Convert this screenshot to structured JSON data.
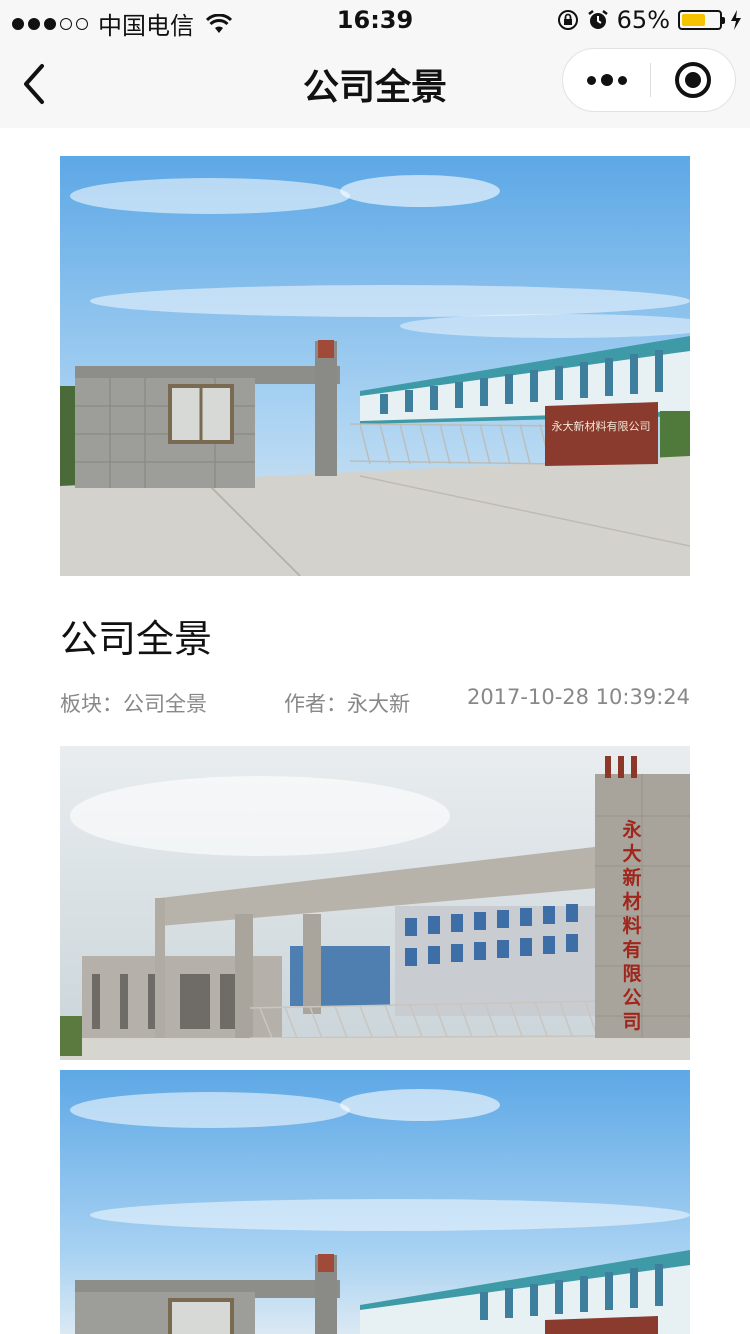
{
  "status_bar": {
    "carrier": "中国电信",
    "time": "16:39",
    "battery_percent": "65%",
    "battery_level": 0.65,
    "signal_bars": 3,
    "signal_total": 5
  },
  "nav": {
    "title": "公司全景",
    "back_icon": "chevron-left-icon",
    "more_icon": "more-dots-icon",
    "close_icon": "target-close-icon"
  },
  "article": {
    "title": "公司全景",
    "board_label": "板块：",
    "board_value": "公司全景",
    "author_label": "作者：",
    "author_value": "永大新",
    "date": "2017-10-28 10:39:24"
  },
  "images": {
    "sign_text": "永大新材料有限公司",
    "gate_text": [
      "永",
      "大",
      "新",
      "材",
      "料",
      "有",
      "限",
      "公",
      "司"
    ]
  }
}
